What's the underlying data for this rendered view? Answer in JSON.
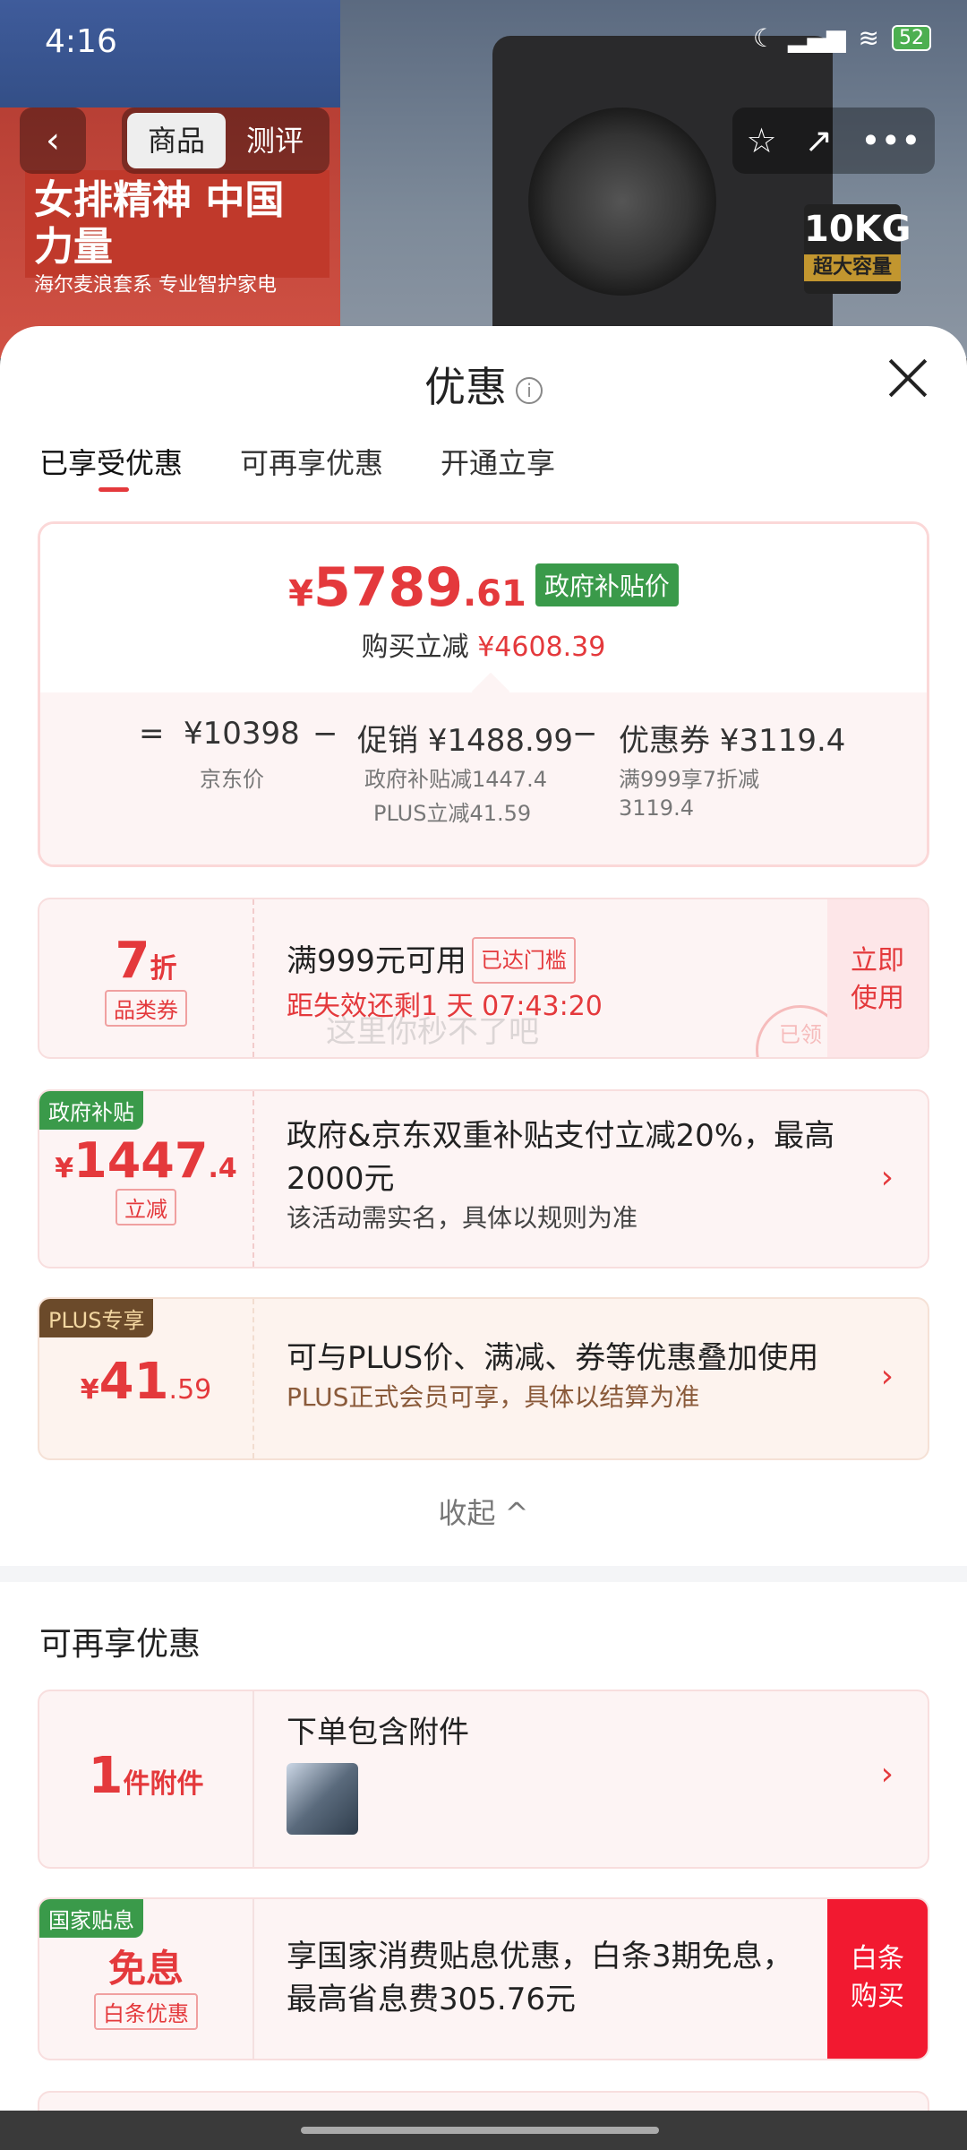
{
  "status": {
    "time": "4:16",
    "battery": "52"
  },
  "nav": {
    "back": "‹",
    "tabs": [
      "商品",
      "测评"
    ],
    "star": "☆",
    "share": "↗",
    "more": "•••"
  },
  "bg": {
    "kg": "10KG",
    "kg_sub": "超大容量",
    "slogan": "女排精神 中国力量",
    "slogan_sub": "海尔麦浪套系 专业智护家电"
  },
  "sheet": {
    "title": "优惠",
    "info_icon": "i",
    "tabs": [
      "已享受优惠",
      "可再享优惠",
      "开通立享"
    ],
    "price": {
      "yen": "¥",
      "int": "5789",
      "dec": ".61",
      "gov_tag": "政府补贴价",
      "reduce_label": "购买立减",
      "reduce_value": "¥4608.39",
      "formula": {
        "eq": "=",
        "jd_price": "¥10398",
        "jd_label": "京东价",
        "minus1": "−",
        "promo": "促销 ¥1488.99",
        "promo_sub1": "政府补贴减1447.4",
        "promo_sub2": "PLUS立减41.59",
        "minus2": "−",
        "coupon": "优惠券 ¥3119.4",
        "coupon_sub1": "满999享7折减",
        "coupon_sub2": "3119.4"
      }
    },
    "coupon1": {
      "num": "7",
      "unit": "折",
      "tag": "品类券",
      "title": "满999元可用",
      "reached": "已达门槛",
      "countdown": "距失效还剩1 天 07:43:20",
      "watermark": "这里你秒不了吧",
      "stamp": "已领",
      "btn": "立即\n使用"
    },
    "gov": {
      "corner": "政府补贴",
      "yen": "¥",
      "int": "1447",
      "dec": ".4",
      "tag": "立减",
      "title": "政府&京东双重补贴支付立减20%，最高2000元",
      "sub": "该活动需实名，具体以规则为准"
    },
    "plus": {
      "corner": "PLUS专享",
      "yen": "¥",
      "int": "41",
      "dec": ".59",
      "title": "可与PLUS价、满减、券等优惠叠加使用",
      "sub": "PLUS正式会员可享，具体以结算为准"
    },
    "collapse": "收起 ^",
    "section2": "可再享优惠",
    "accessory": {
      "num": "1",
      "unit": "件附件",
      "title": "下单包含附件"
    },
    "interest": {
      "corner": "国家贴息",
      "main": "免息",
      "tag": "白条优惠",
      "title": "享国家消费贴息优惠，白条3期免息，最高省息费305.76元",
      "btn": "白条\n购买"
    }
  },
  "colors": {
    "accent": "#e4393c",
    "green": "#3a9a4a",
    "brown": "#6b4a2a"
  }
}
